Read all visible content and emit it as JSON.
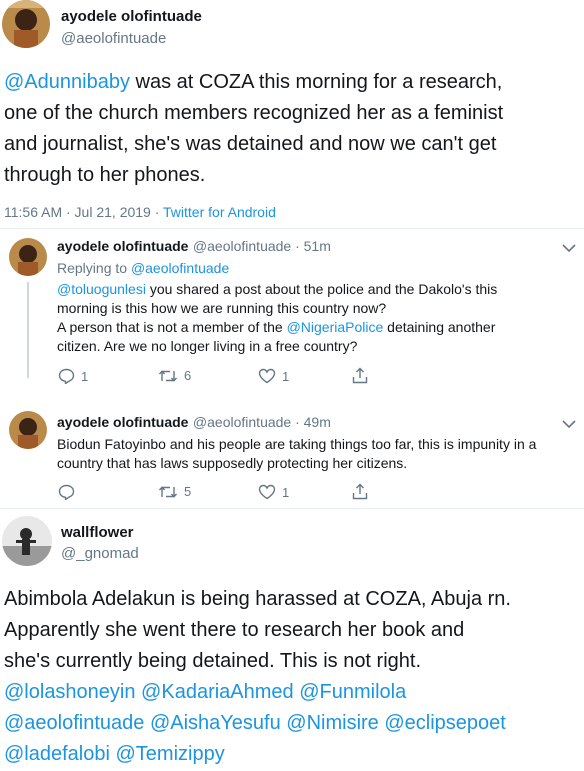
{
  "main_tweet": {
    "name": "ayodele olofintuade",
    "handle": "@aeolofintuade",
    "mention": "@Adunnibaby",
    "lines": [
      " was at COZA  this morning for a research,",
      "one of the church members recognized her as a feminist",
      "and journalist, she's was detained and now we can't get",
      "through to her phones."
    ],
    "timestamp": "11:56 AM · Jul 21, 2019 · ",
    "client": "Twitter for Android"
  },
  "reply1": {
    "name": "ayodele olofintuade",
    "handle_time": "@aeolofintuade · 51m",
    "replying_to_label": "Replying to ",
    "replying_to_handle": "@aeolofintuade",
    "line1_mention": "@toluogunlesi",
    "line1_text": " you shared a post about the police and the Dakolo's this",
    "line2": "morning is this how we are running this country now?",
    "line3_pre": "A person that is not a member of the ",
    "line3_mention": "@NigeriaPolice",
    "line3_post": " detaining another",
    "line4": "citizen. Are we no longer living in a free country?",
    "replies": "1",
    "retweets": "6",
    "likes": "1"
  },
  "reply2": {
    "name": "ayodele olofintuade",
    "handle_time": "@aeolofintuade · 49m",
    "line1": "Biodun Fatoyinbo and his people are taking things too far, this is impunity in a",
    "line2": "country that has laws supposedly protecting her citizens.",
    "retweets": "5",
    "likes": "1"
  },
  "quote_tweet": {
    "name": "wallflower",
    "handle": "@_gnomad",
    "lines": [
      "Abimbola Adelakun is being harassed at COZA, Abuja rn.",
      "Apparently she went there to research her book and",
      "she's currently being detained. This is not right."
    ],
    "mentions_line1": "@lolashoneyin @KadariaAhmed @Funmilola",
    "mentions_line2": "@aeolofintuade @AishaYesufu @Nimisire @eclipsepoet",
    "mentions_line3": "@ladefalobi @Temizippy"
  },
  "colors": {
    "link": "#1b95e0",
    "muted": "#657786",
    "text": "#14171a",
    "divider": "#e6ecf0"
  },
  "icons": [
    "reply-icon",
    "retweet-icon",
    "like-icon",
    "share-icon",
    "chevron-down-icon"
  ]
}
